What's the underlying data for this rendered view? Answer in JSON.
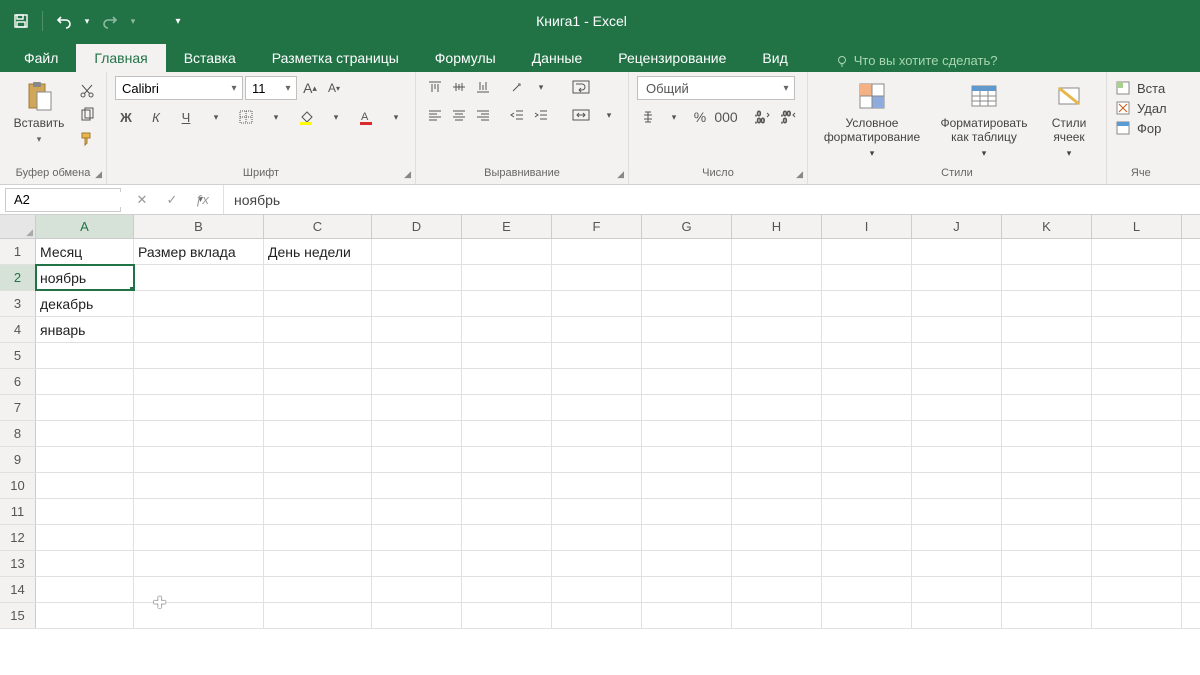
{
  "titlebar": {
    "title": "Книга1 - Excel"
  },
  "tabs": {
    "file": "Файл",
    "home": "Главная",
    "insert": "Вставка",
    "page_layout": "Разметка страницы",
    "formulas": "Формулы",
    "data": "Данные",
    "review": "Рецензирование",
    "view": "Вид",
    "tell_me": "Что вы хотите сделать?"
  },
  "ribbon": {
    "clipboard": {
      "label": "Буфер обмена",
      "paste": "Вставить"
    },
    "font": {
      "label": "Шрифт",
      "name": "Calibri",
      "size": "11",
      "bold": "Ж",
      "italic": "К",
      "underline": "Ч"
    },
    "alignment": {
      "label": "Выравнивание"
    },
    "number": {
      "label": "Число",
      "format": "Общий"
    },
    "styles": {
      "label": "Стили",
      "cond_fmt": "Условное форматирование",
      "as_table": "Форматировать как таблицу",
      "cell_styles": "Стили ячеек"
    },
    "cells": {
      "label": "Яче",
      "insert": "Вста",
      "delete": "Удал",
      "format": "Фор"
    }
  },
  "namebox": "A2",
  "formula": "ноябрь",
  "columns": [
    "A",
    "B",
    "C",
    "D",
    "E",
    "F",
    "G",
    "H",
    "I",
    "J",
    "K",
    "L"
  ],
  "rows": {
    "r1": {
      "A": "Месяц",
      "B": "Размер вклада",
      "C": "День недели"
    },
    "r2": {
      "A": "ноябрь"
    },
    "r3": {
      "A": "декабрь"
    },
    "r4": {
      "A": "январь"
    }
  },
  "active_cell": "A2"
}
